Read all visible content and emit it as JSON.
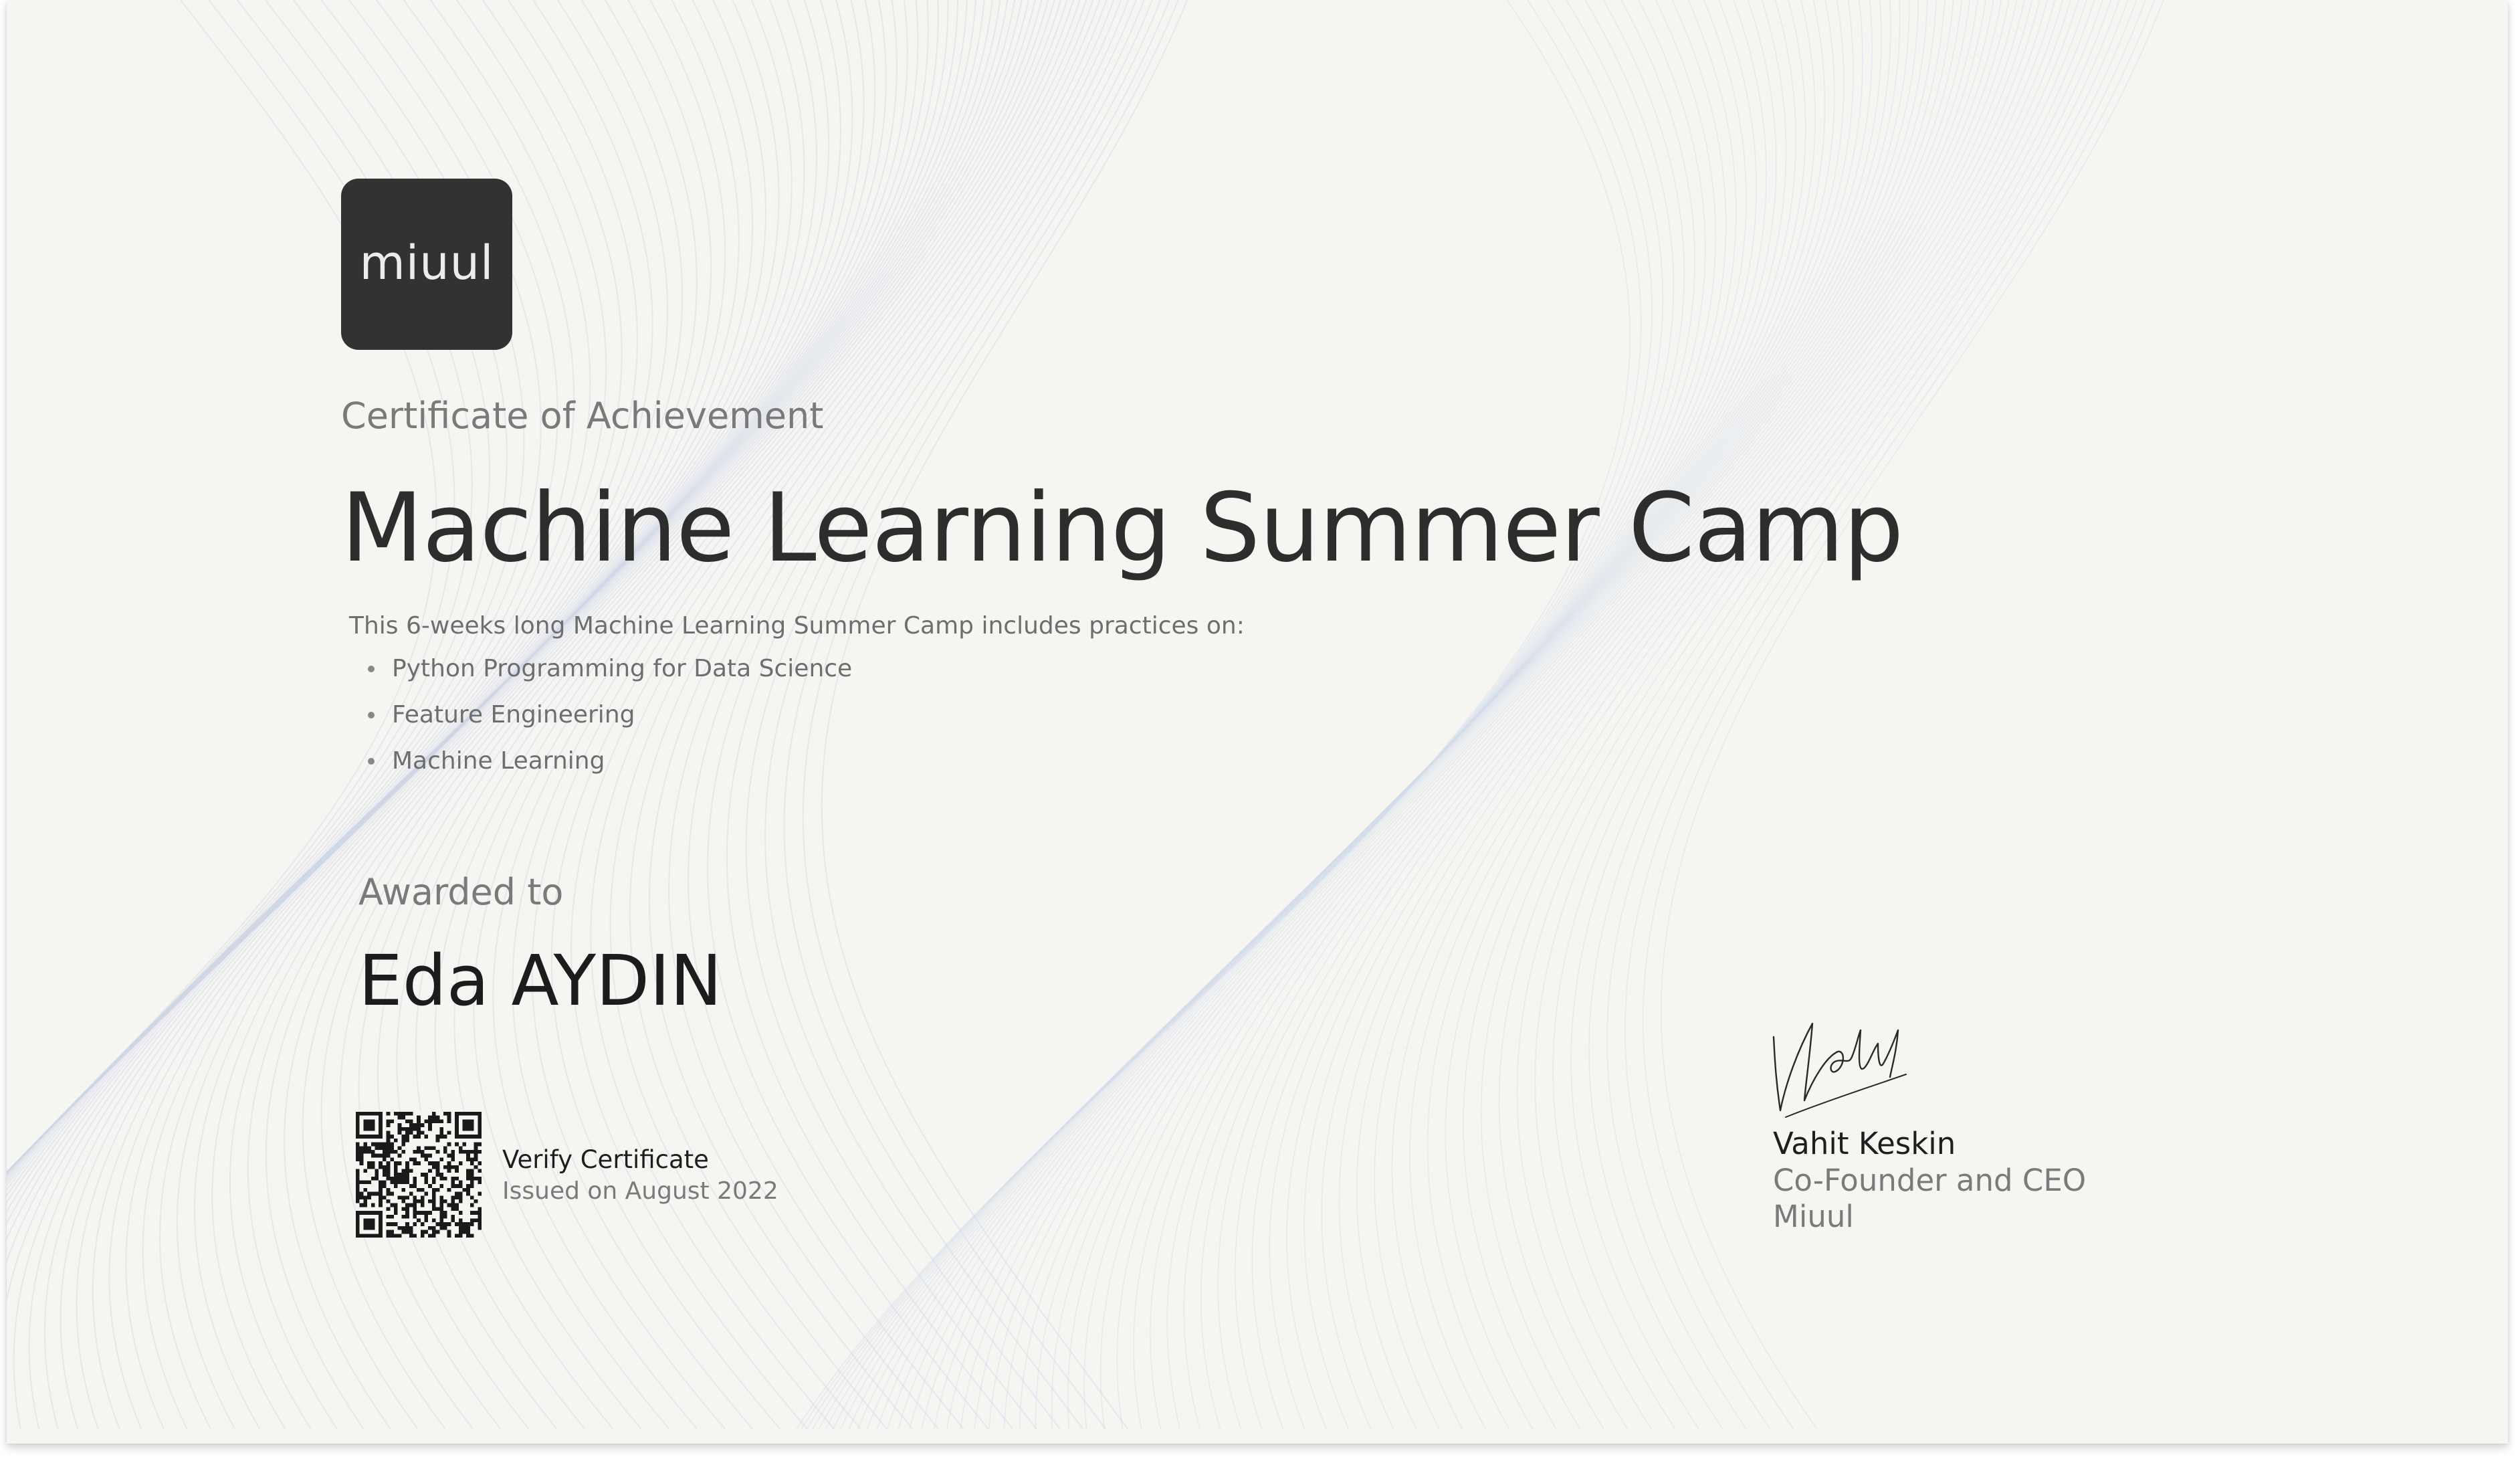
{
  "logo": {
    "text": "miuul"
  },
  "certificate": {
    "subtitle": "Certificate of Achievement",
    "title": "Machine Learning Summer Camp",
    "description": "This 6-weeks long Machine Learning Summer Camp includes practices on:",
    "practices": [
      "Python Programming for Data Science",
      "Feature Engineering",
      "Machine Learning"
    ]
  },
  "award": {
    "label": "Awarded to",
    "recipient": "Eda AYDIN"
  },
  "verification": {
    "link_label": "Verify Certificate",
    "issued": "Issued on August 2022"
  },
  "signatory": {
    "name": "Vahit Keskin",
    "role": "Co-Founder and CEO",
    "company": "Miuul"
  },
  "colors": {
    "background": "#f6f5f2",
    "logo_box": "#323232",
    "wave_lines": "#cfd6e6",
    "text_dark": "#2d2d2d",
    "text_muted": "#7a7a7a"
  }
}
